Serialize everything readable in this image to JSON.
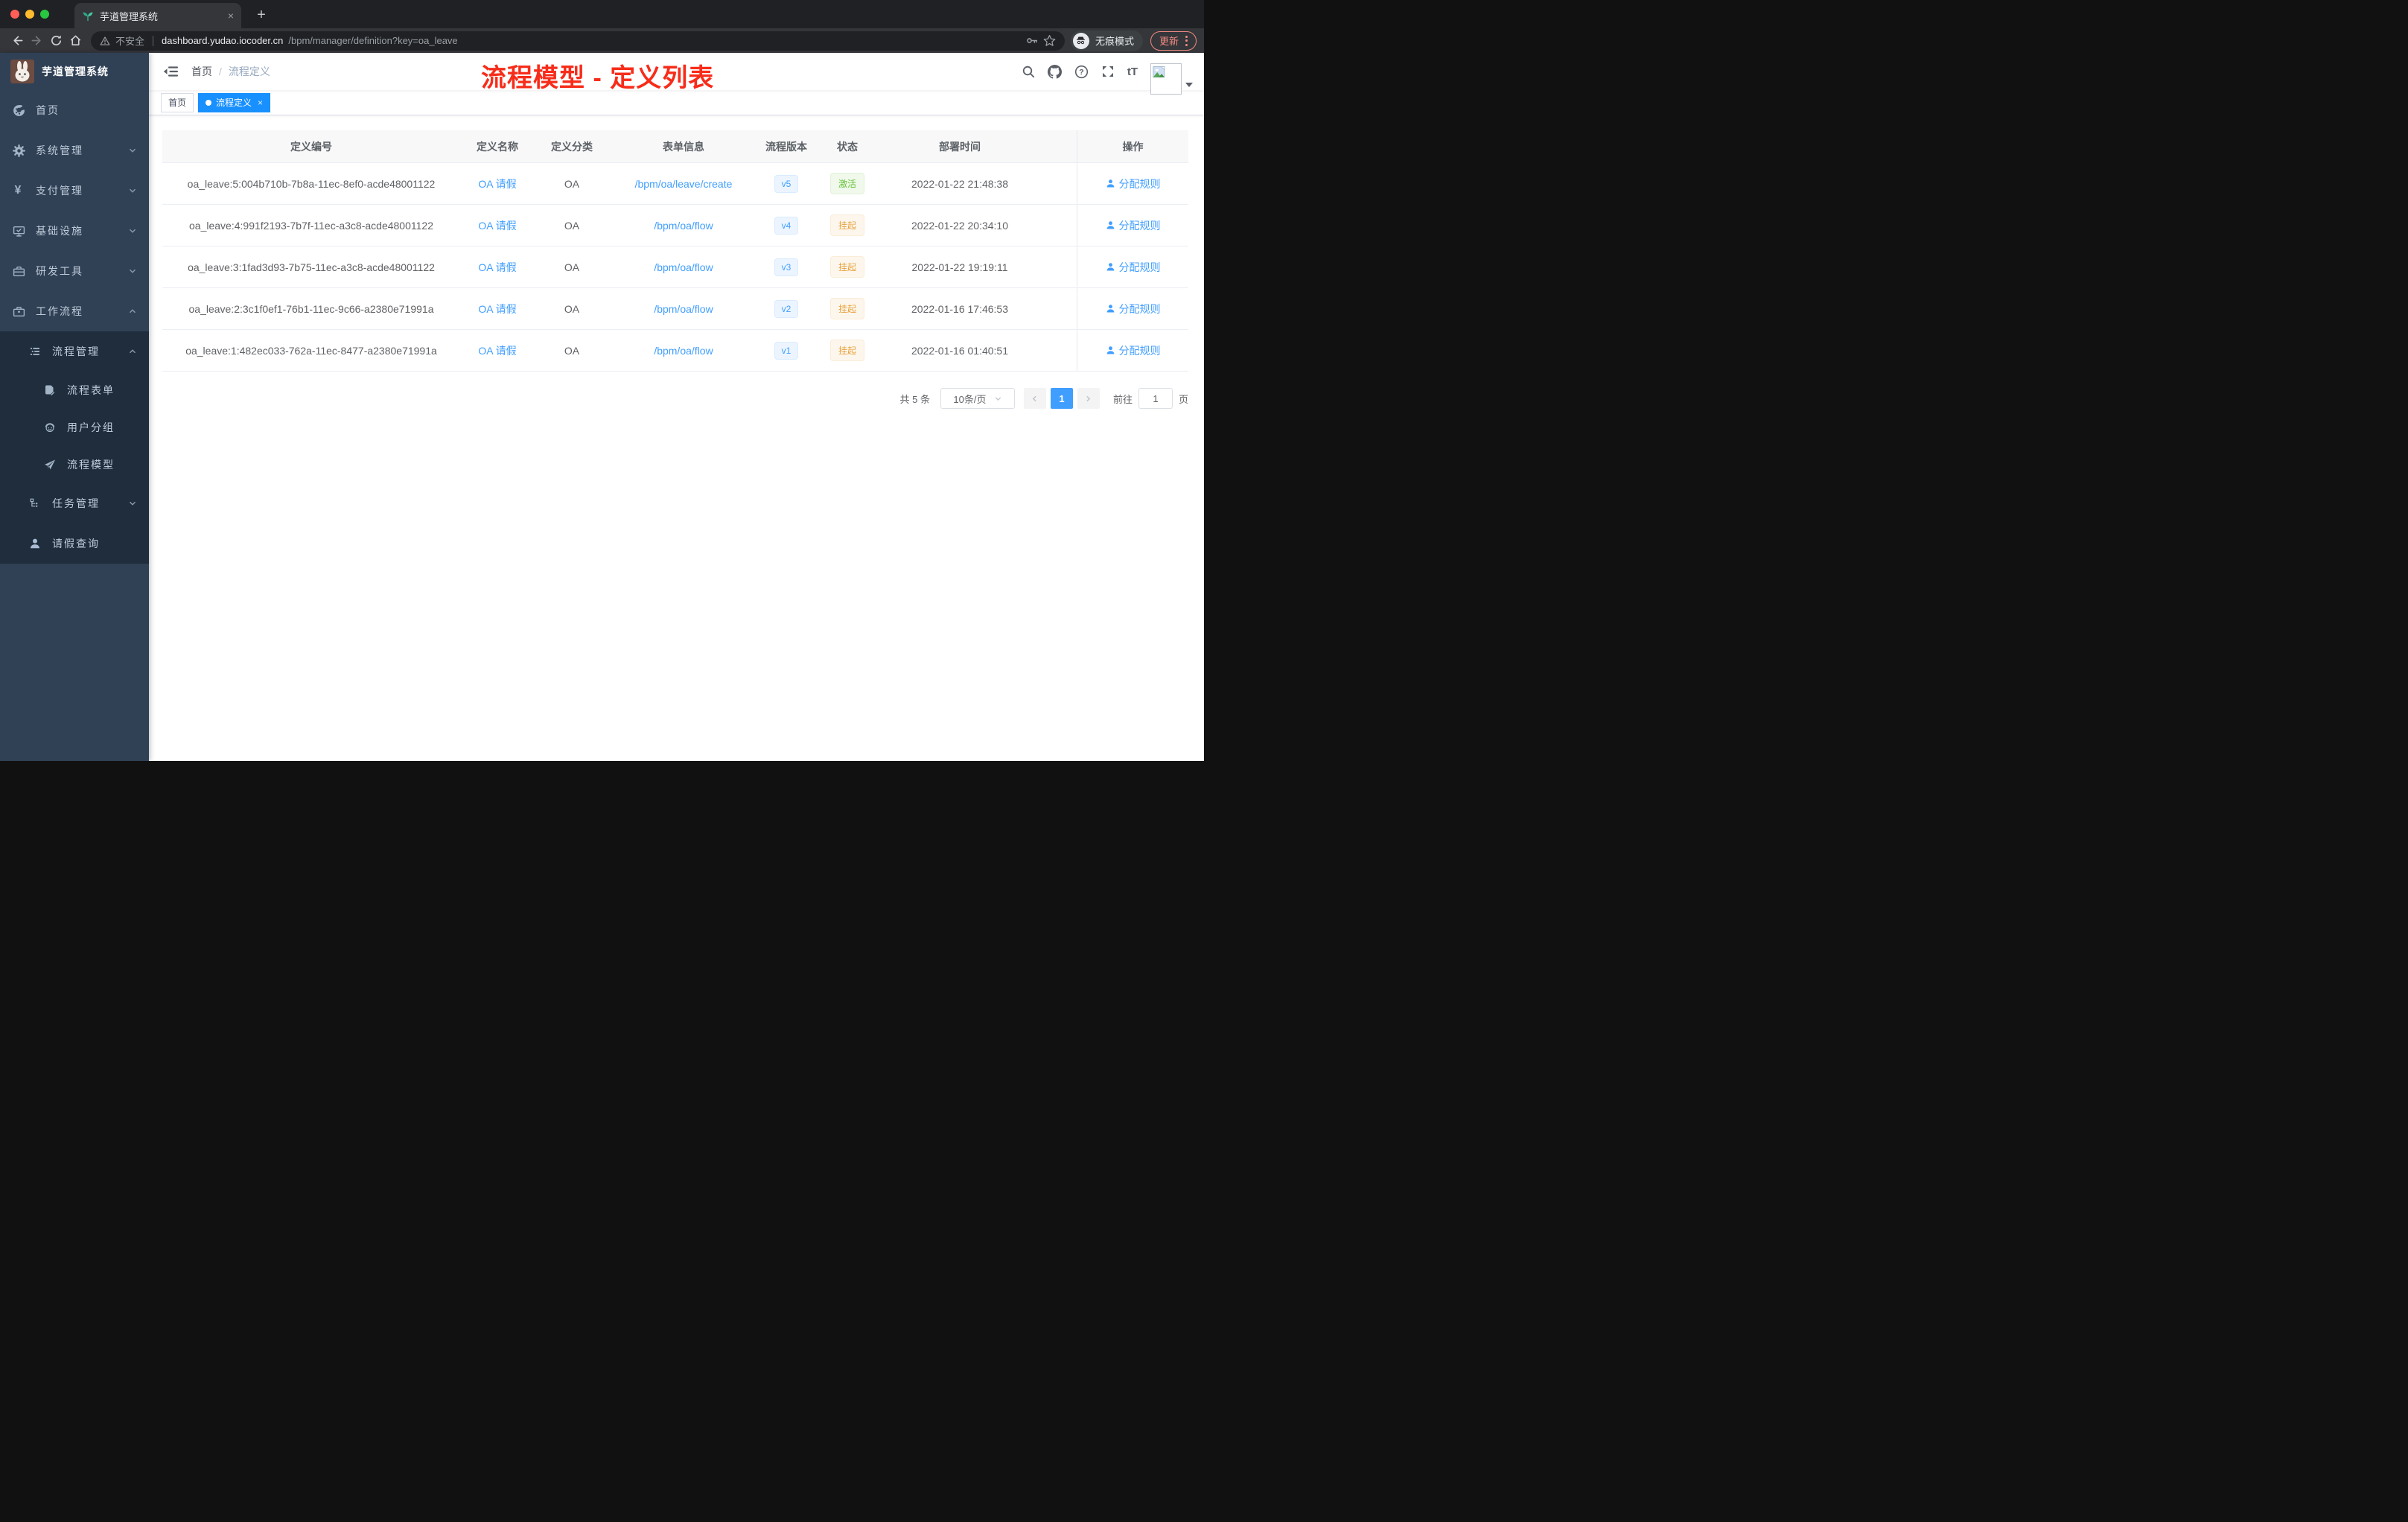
{
  "icons": {
    "close": "×",
    "plus": "+"
  },
  "browser": {
    "tab": {
      "title": "芋道管理系统"
    },
    "address": {
      "security_label": "不安全",
      "domain": "dashboard.yudao.iocoder.cn",
      "path": "/bpm/manager/definition?key=oa_leave"
    },
    "incognito_label": "无痕模式",
    "update_label": "更新"
  },
  "sidebar": {
    "logo_title": "芋道管理系统",
    "items": [
      {
        "label": "首页"
      },
      {
        "label": "系统管理"
      },
      {
        "label": "支付管理"
      },
      {
        "label": "基础设施"
      },
      {
        "label": "研发工具"
      },
      {
        "label": "工作流程"
      }
    ],
    "submenu": {
      "process_management": {
        "label": "流程管理"
      },
      "children": [
        {
          "label": "流程表单"
        },
        {
          "label": "用户分组"
        },
        {
          "label": "流程模型"
        }
      ],
      "task_management": {
        "label": "任务管理"
      },
      "leave_query": {
        "label": "请假查询"
      }
    }
  },
  "navbar": {
    "breadcrumb": {
      "home": "首页",
      "separator": "/",
      "current": "流程定义"
    },
    "annotation": {
      "text": "流程模型 - 定义列表",
      "color": "#f72c1a"
    }
  },
  "tags_view": {
    "tags": [
      {
        "label": "首页",
        "active": false
      },
      {
        "label": "流程定义",
        "active": true
      }
    ]
  },
  "table": {
    "headers": [
      "定义编号",
      "定义名称",
      "定义分类",
      "表单信息",
      "流程版本",
      "状态",
      "部署时间",
      "操作"
    ],
    "rows": [
      {
        "id": "oa_leave:5:004b710b-7b8a-11ec-8ef0-acde48001122",
        "name": "OA 请假",
        "category": "OA",
        "form": "/bpm/oa/leave/create",
        "version": "v5",
        "status": "激活",
        "status_type": "success",
        "deploy_time": "2022-01-22 21:48:38",
        "action": "分配规则"
      },
      {
        "id": "oa_leave:4:991f2193-7b7f-11ec-a3c8-acde48001122",
        "name": "OA 请假",
        "category": "OA",
        "form": "/bpm/oa/flow",
        "version": "v4",
        "status": "挂起",
        "status_type": "warning",
        "deploy_time": "2022-01-22 20:34:10",
        "action": "分配规则"
      },
      {
        "id": "oa_leave:3:1fad3d93-7b75-11ec-a3c8-acde48001122",
        "name": "OA 请假",
        "category": "OA",
        "form": "/bpm/oa/flow",
        "version": "v3",
        "status": "挂起",
        "status_type": "warning",
        "deploy_time": "2022-01-22 19:19:11",
        "action": "分配规则"
      },
      {
        "id": "oa_leave:2:3c1f0ef1-76b1-11ec-9c66-a2380e71991a",
        "name": "OA 请假",
        "category": "OA",
        "form": "/bpm/oa/flow",
        "version": "v2",
        "status": "挂起",
        "status_type": "warning",
        "deploy_time": "2022-01-16 17:46:53",
        "action": "分配规则"
      },
      {
        "id": "oa_leave:1:482ec033-762a-11ec-8477-a2380e71991a",
        "name": "OA 请假",
        "category": "OA",
        "form": "/bpm/oa/flow",
        "version": "v1",
        "status": "挂起",
        "status_type": "warning",
        "deploy_time": "2022-01-16 01:40:51",
        "action": "分配规则"
      }
    ]
  },
  "pagination": {
    "total": "共 5 条",
    "page_size": "10条/页",
    "current_page": "1",
    "goto_prefix": "前往",
    "goto_value": "1",
    "goto_suffix": "页"
  },
  "colors": {
    "accent_blue": "#409eff",
    "active_tag_blue": "#1890ff",
    "status_active_green": "#67c23a",
    "status_suspended_orange": "#e6a23c",
    "sidebar_bg": "#304156",
    "submenu_bg": "#1f2d3d",
    "annotation_red": "#f72c1a"
  }
}
